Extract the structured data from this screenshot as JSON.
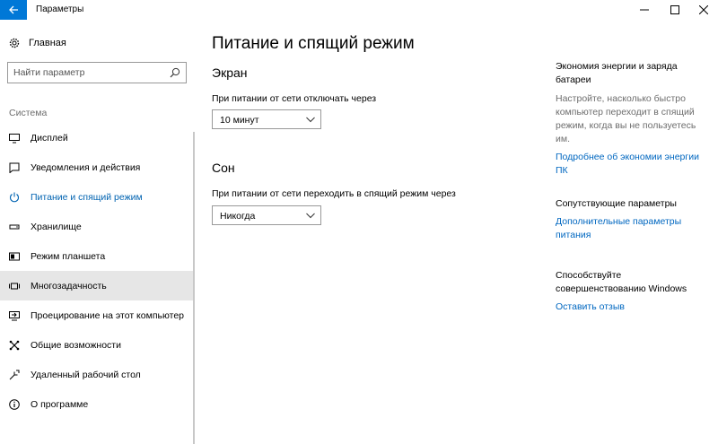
{
  "window": {
    "title": "Параметры"
  },
  "sidebar": {
    "home_label": "Главная",
    "search_placeholder": "Найти параметр",
    "section_label": "Система",
    "items": [
      {
        "label": "Дисплей"
      },
      {
        "label": "Уведомления и действия"
      },
      {
        "label": "Питание и спящий режим"
      },
      {
        "label": "Хранилище"
      },
      {
        "label": "Режим планшета"
      },
      {
        "label": "Многозадачность"
      },
      {
        "label": "Проецирование на этот компьютер"
      },
      {
        "label": "Общие возможности"
      },
      {
        "label": "Удаленный рабочий стол"
      },
      {
        "label": "О программе"
      }
    ],
    "active_item": "Питание и спящий режим",
    "hovered_item": "Многозадачность"
  },
  "main": {
    "title": "Питание и спящий режим",
    "screen": {
      "heading": "Экран",
      "label": "При питании от сети отключать через",
      "value": "10 минут"
    },
    "sleep": {
      "heading": "Сон",
      "label": "При питании от сети переходить в спящий режим через",
      "value": "Никогда"
    }
  },
  "aside": {
    "energy": {
      "heading": "Экономия энергии и заряда батареи",
      "description": "Настройте, насколько быстро компьютер переходит в спящий режим, когда вы не пользуетесь им.",
      "link": "Подробнее об экономии энергии ПК"
    },
    "related": {
      "heading": "Сопутствующие параметры",
      "link": "Дополнительные параметры питания"
    },
    "feedback": {
      "heading": "Способствуйте совершенствованию Windows",
      "link": "Оставить отзыв"
    }
  },
  "colors": {
    "accent": "#0078d7",
    "link": "#0067c0",
    "hover_bg": "#e6e6e6",
    "secondary_text": "#6d6d6d"
  },
  "icons": [
    "back-arrow-icon",
    "minimize-icon",
    "maximize-icon",
    "close-icon",
    "home-gear-icon",
    "search-icon",
    "display-icon",
    "notifications-icon",
    "power-icon",
    "storage-icon",
    "tablet-mode-icon",
    "multitasking-icon",
    "projecting-icon",
    "shared-experiences-icon",
    "remote-desktop-icon",
    "info-icon",
    "chevron-down-icon"
  ]
}
